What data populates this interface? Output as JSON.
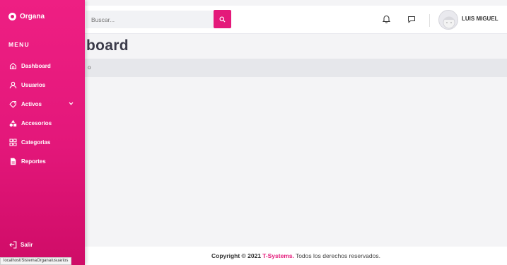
{
  "topbar": {
    "search": {
      "placeholder": "Buscar...",
      "value": ""
    },
    "user_name": "LUIS MIGUEL"
  },
  "page": {
    "title": "board",
    "breadcrumb": "o"
  },
  "sidebar": {
    "brand": "Organa",
    "menu_heading": "MENU",
    "items": [
      {
        "label": "Dashboard",
        "icon": "home-icon"
      },
      {
        "label": "Usuarios",
        "icon": "user-icon"
      },
      {
        "label": "Activos",
        "icon": "tag-icon",
        "has_submenu": true
      },
      {
        "label": "Accesorios",
        "icon": "shapes-icon"
      },
      {
        "label": "Categorias",
        "icon": "grid-icon"
      },
      {
        "label": "Reportes",
        "icon": "document-icon"
      }
    ],
    "logout": "Salir"
  },
  "footer": {
    "prefix": "Copyright © 2021",
    "brand": "T-Systems.",
    "suffix": "Todos los derechos reservados."
  },
  "status_bar": {
    "url": "localhost/SistemaOrgana/usuarios"
  },
  "colors": {
    "accent": "#e4197a",
    "sidebar_dark": "#cf0c67",
    "background": "#f4f4f6"
  }
}
